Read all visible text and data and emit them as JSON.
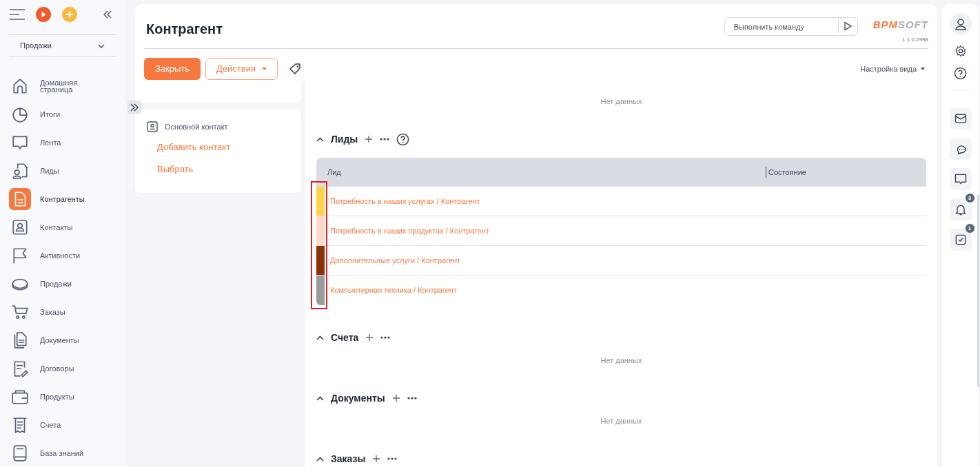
{
  "sidebar": {
    "section_select": "Продажи",
    "items": [
      {
        "label": "Домашняя страница",
        "selected": false
      },
      {
        "label": "Итоги",
        "selected": false
      },
      {
        "label": "Лента",
        "selected": false
      },
      {
        "label": "Лиды",
        "selected": false
      },
      {
        "label": "Контрагенты",
        "selected": true
      },
      {
        "label": "Контакты",
        "selected": false
      },
      {
        "label": "Активности",
        "selected": false
      },
      {
        "label": "Продажи",
        "selected": false
      },
      {
        "label": "Заказы",
        "selected": false
      },
      {
        "label": "Документы",
        "selected": false
      },
      {
        "label": "Договоры",
        "selected": false
      },
      {
        "label": "Продукты",
        "selected": false
      },
      {
        "label": "Счета",
        "selected": false
      },
      {
        "label": "База знаний",
        "selected": false
      }
    ]
  },
  "header": {
    "title": "Контрагент",
    "command_placeholder": "Выполнить команду",
    "logo": {
      "accent": "BPM",
      "rest": "SOFT"
    },
    "version": "1.1.0.2998"
  },
  "toolbar": {
    "close_button": "Закрыть",
    "actions_button": "Действия",
    "view_settings": "Настройка вида"
  },
  "contact_card": {
    "label": "Основной контакт",
    "links": [
      "Добавить контакт",
      "Выбрать"
    ]
  },
  "sections": [
    {
      "kind": "empty",
      "empty_text": "Нет данных"
    },
    {
      "kind": "table",
      "title": "Лиды",
      "help": true,
      "columns": [
        "Лид",
        "Состояние"
      ],
      "rows": [
        {
          "text": "Потребность в наших услугах / Контрагент",
          "color": "#fcd34d"
        },
        {
          "text": "Потребность в наших продуктах / Контрагент",
          "color": "#fdd8c8"
        },
        {
          "text": "Дополнительные услуги / Контрагент",
          "color": "#8c3209"
        },
        {
          "text": "Компьютерная техника / Контрагент",
          "color": "#9b9b9b"
        }
      ]
    },
    {
      "kind": "empty",
      "title": "Счета",
      "empty_text": "Нет данных"
    },
    {
      "kind": "empty",
      "title": "Документы",
      "empty_text": "Нет данных"
    },
    {
      "kind": "header",
      "title": "Заказы"
    }
  ],
  "right_rail": {
    "badges": [
      {
        "kind": "bell",
        "count": "3"
      },
      {
        "kind": "tasks",
        "count": "1"
      }
    ]
  }
}
